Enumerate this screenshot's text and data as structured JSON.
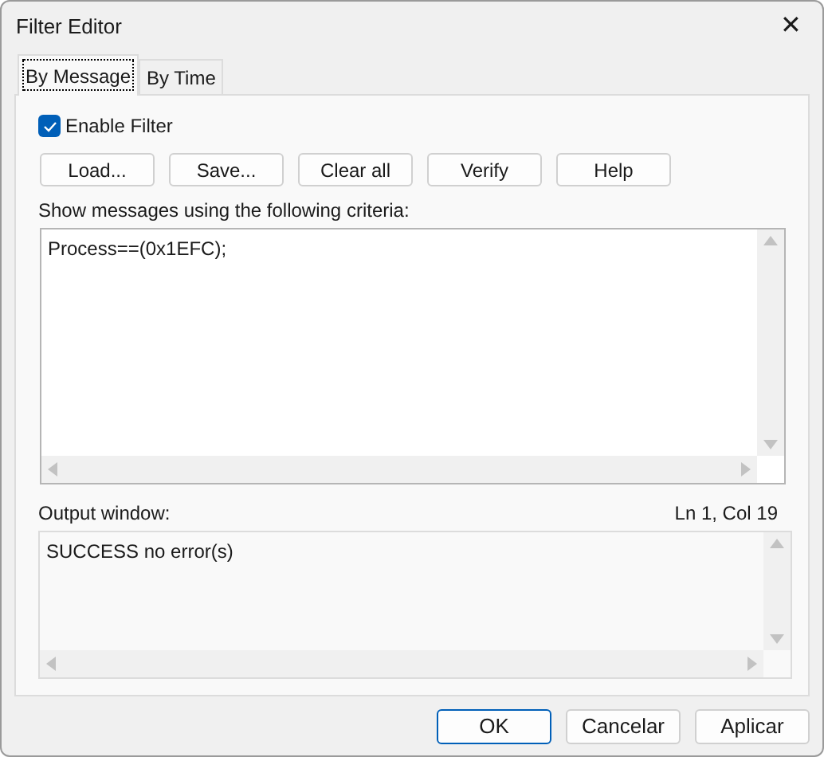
{
  "window": {
    "title": "Filter Editor",
    "close": "✕"
  },
  "tabs": [
    {
      "label": "By Message",
      "selected": true
    },
    {
      "label": "By Time",
      "selected": false
    }
  ],
  "enable_filter": {
    "label": "Enable Filter",
    "checked": true
  },
  "toolbar_buttons": [
    "Load...",
    "Save...",
    "Clear all",
    "Verify",
    "Help"
  ],
  "criteria": {
    "label": "Show messages using the following criteria:",
    "value": "Process==(0x1EFC);"
  },
  "output": {
    "label": "Output window:",
    "position": "Ln 1, Col 19",
    "text": "SUCCESS no error(s)"
  },
  "dialog_buttons": [
    {
      "label": "OK",
      "default": true
    },
    {
      "label": "Cancelar",
      "default": false
    },
    {
      "label": "Aplicar",
      "default": false
    }
  ]
}
